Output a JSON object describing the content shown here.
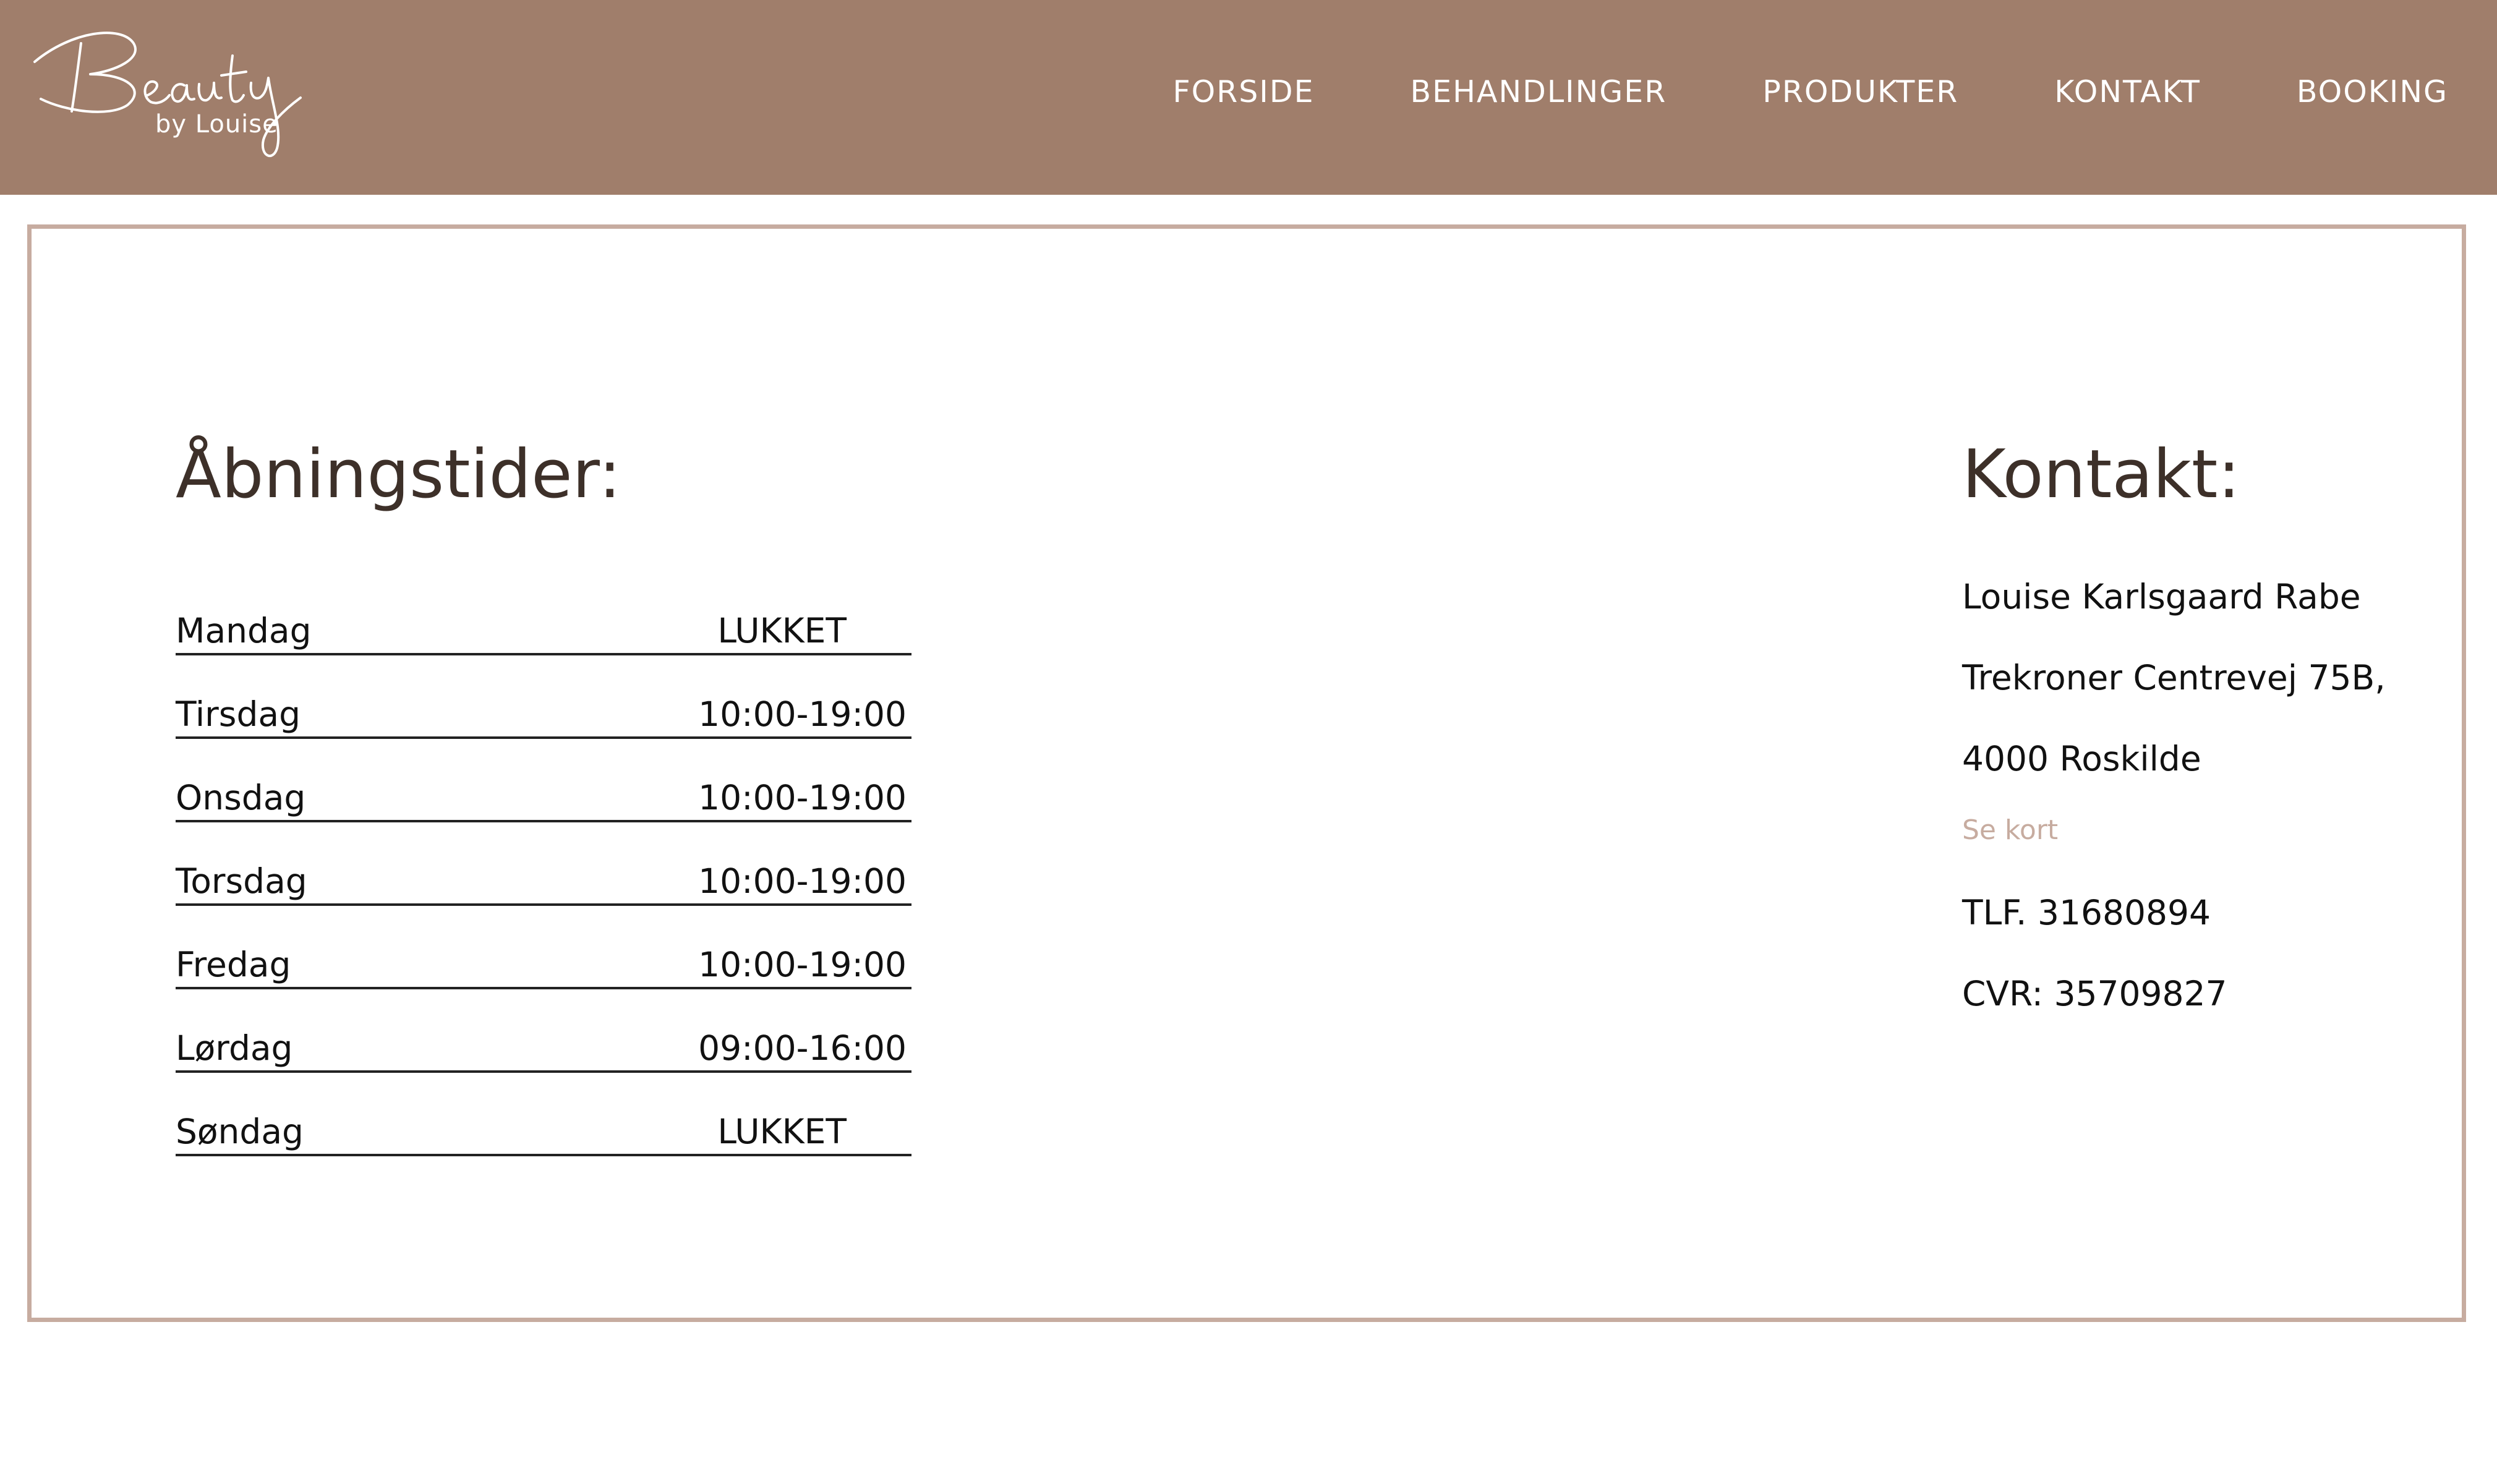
{
  "header": {
    "logo_script": "Beauty",
    "logo_sub": "by Louise",
    "nav": [
      "FORSIDE",
      "BEHANDLINGER",
      "PRODUKTER",
      "KONTAKT",
      "BOOKING"
    ]
  },
  "hours": {
    "title": "Åbningstider:",
    "rows": [
      {
        "day": "Mandag",
        "time": "LUKKET"
      },
      {
        "day": "Tirsdag",
        "time": "10:00-19:00"
      },
      {
        "day": "Onsdag",
        "time": "10:00-19:00"
      },
      {
        "day": "Torsdag",
        "time": "10:00-19:00"
      },
      {
        "day": "Fredag",
        "time": "10:00-19:00"
      },
      {
        "day": "Lørdag",
        "time": "09:00-16:00"
      },
      {
        "day": "Søndag",
        "time": "LUKKET"
      }
    ]
  },
  "contact": {
    "title": "Kontakt:",
    "name": "Louise Karlsgaard Rabe",
    "street": "Trekroner Centrevej 75B,",
    "city": "4000 Roskilde",
    "map_link": "Se kort",
    "phone": "TLF. 31680894",
    "cvr": "CVR: 35709827"
  },
  "colors": {
    "header_bg": "#a07e6b",
    "border": "#c7aca0",
    "heading": "#3d3029",
    "link": "#c7aca0"
  }
}
